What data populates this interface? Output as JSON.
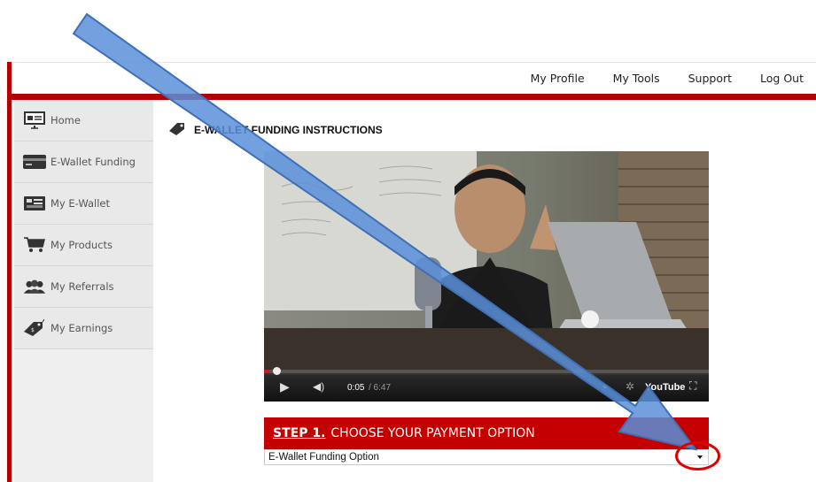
{
  "topnav": {
    "items": [
      "My Profile",
      "My Tools",
      "Support",
      "Log Out"
    ]
  },
  "sidebar": {
    "items": [
      {
        "label": "Home",
        "icon": "presentation-icon"
      },
      {
        "label": "E-Wallet Funding",
        "icon": "credit-card-icon"
      },
      {
        "label": "My E-Wallet",
        "icon": "wallet-icon"
      },
      {
        "label": "My Products",
        "icon": "shopping-cart-icon"
      },
      {
        "label": "My Referrals",
        "icon": "users-icon"
      },
      {
        "label": "My Earnings",
        "icon": "price-tag-icon"
      }
    ]
  },
  "main": {
    "title": "E-WALLET FUNDING INSTRUCTIONS",
    "video": {
      "time_current": "0:05",
      "time_total": "/ 6:47",
      "progress": 0.0123,
      "brand": "YouTube"
    },
    "step": {
      "number": "STEP 1.",
      "text": "CHOOSE YOUR PAYMENT OPTION"
    },
    "payment_select": {
      "value": "E-Wallet Funding Option"
    }
  },
  "colors": {
    "brand_red": "#b40000",
    "step_red": "#c40000",
    "annotation_arrow": "#5b8fd9",
    "annotation_circle": "#e00000"
  }
}
